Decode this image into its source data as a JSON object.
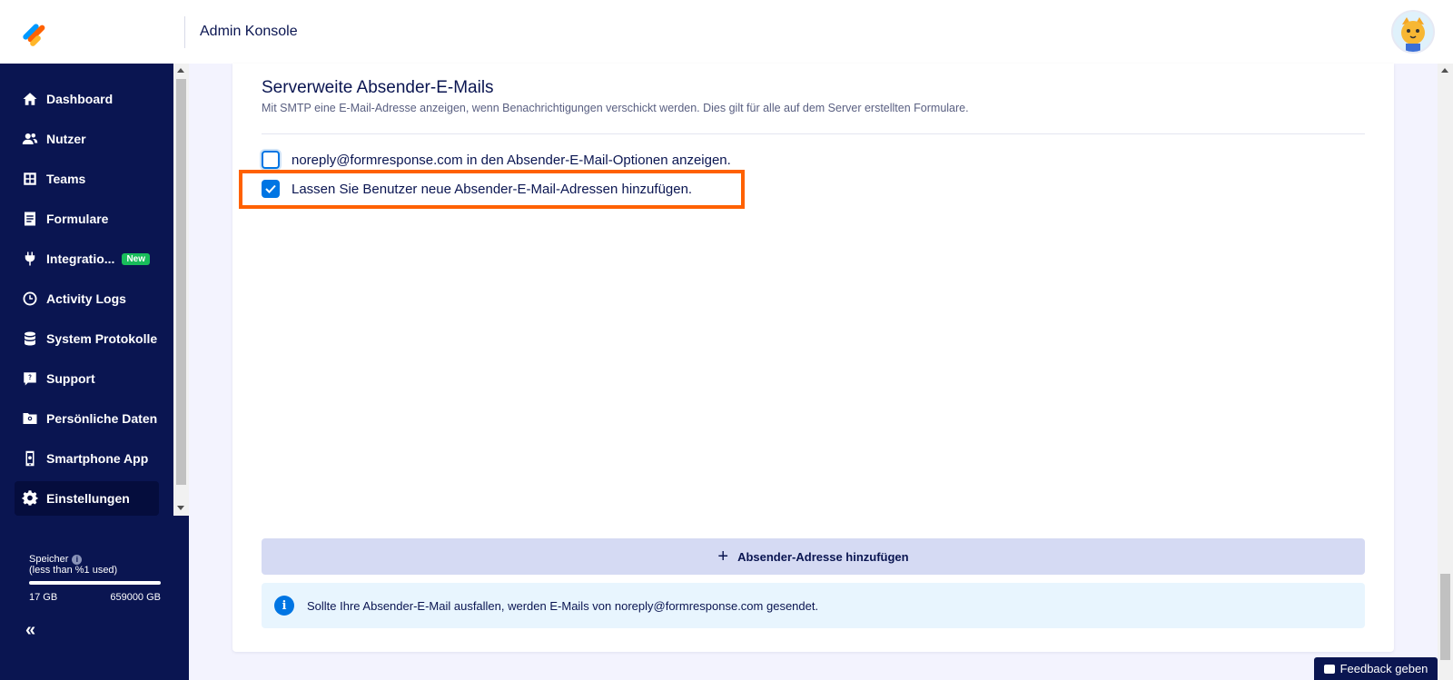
{
  "header": {
    "app_title": "Admin Konsole"
  },
  "sidebar": {
    "items": [
      {
        "label": "Dashboard",
        "icon": "home-icon"
      },
      {
        "label": "Nutzer",
        "icon": "users-icon"
      },
      {
        "label": "Teams",
        "icon": "teams-icon"
      },
      {
        "label": "Formulare",
        "icon": "form-icon"
      },
      {
        "label": "Integratio...",
        "icon": "plug-icon",
        "badge": "New"
      },
      {
        "label": "Activity Logs",
        "icon": "clock-icon"
      },
      {
        "label": "System Protokolle",
        "icon": "database-icon"
      },
      {
        "label": "Support",
        "icon": "help-icon"
      },
      {
        "label": "Persönliche Daten",
        "icon": "folder-search-icon"
      },
      {
        "label": "Smartphone App",
        "icon": "phone-settings-icon"
      },
      {
        "label": "Einstellungen",
        "icon": "gear-icon",
        "active": true
      }
    ],
    "storage": {
      "label": "Speicher",
      "usage_text": "(less than %1 used)",
      "used": "17 GB",
      "total": "659000 GB"
    }
  },
  "section": {
    "title": "Serverweite Absender-E-Mails",
    "description": "Mit SMTP eine E-Mail-Adresse anzeigen, wenn Benachrichtigungen verschickt werden. Dies gilt für alle auf dem Server erstellten Formulare.",
    "options": [
      {
        "label": "noreply@formresponse.com in den Absender-E-Mail-Optionen anzeigen.",
        "checked": false
      },
      {
        "label": "Lassen Sie Benutzer neue Absender-E-Mail-Adressen hinzufügen.",
        "checked": true
      }
    ],
    "add_button_label": "Absender-Adresse hinzufügen",
    "info_text": "Sollte Ihre Absender-E-Mail ausfallen, werden E-Mails von noreply@formresponse.com gesendet."
  },
  "feedback_label": "Feedback geben",
  "colors": {
    "sidebar_bg": "#0a1551",
    "accent_blue": "#0075e3",
    "highlight_orange": "#ff6100",
    "badge_green": "#18bd5b"
  }
}
